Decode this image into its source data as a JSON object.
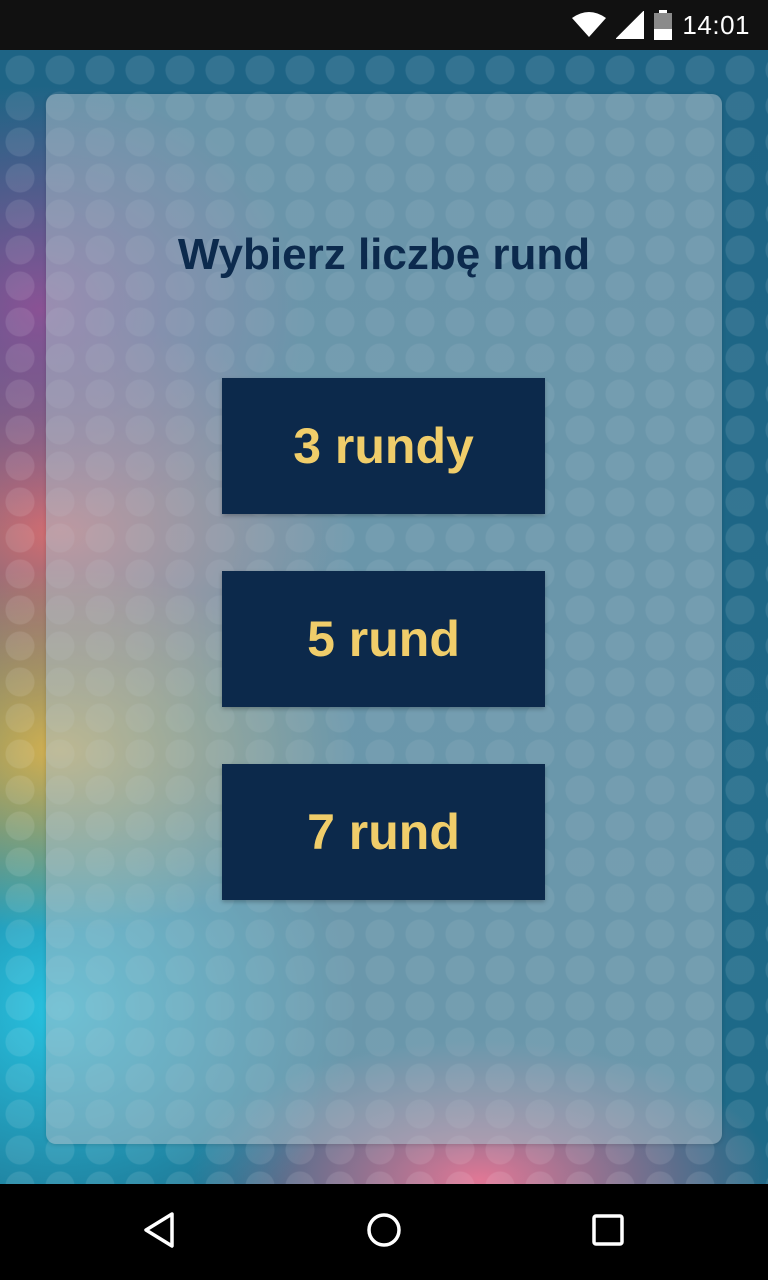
{
  "status_bar": {
    "time": "14:01",
    "icons": [
      "wifi-icon",
      "signal-icon",
      "battery-icon"
    ]
  },
  "screen": {
    "title": "Wybierz liczbę rund",
    "options": [
      {
        "label": "3 rundy"
      },
      {
        "label": "5 rund"
      },
      {
        "label": "7 rund"
      }
    ]
  },
  "nav_bar": {
    "icons": [
      "back-icon",
      "home-icon",
      "recents-icon"
    ]
  },
  "colors": {
    "button_bg": "#0c294b",
    "button_text": "#f0cd6a",
    "title_text": "#0c2a4d",
    "status_bar": "#111111",
    "nav_bar": "#000000"
  }
}
